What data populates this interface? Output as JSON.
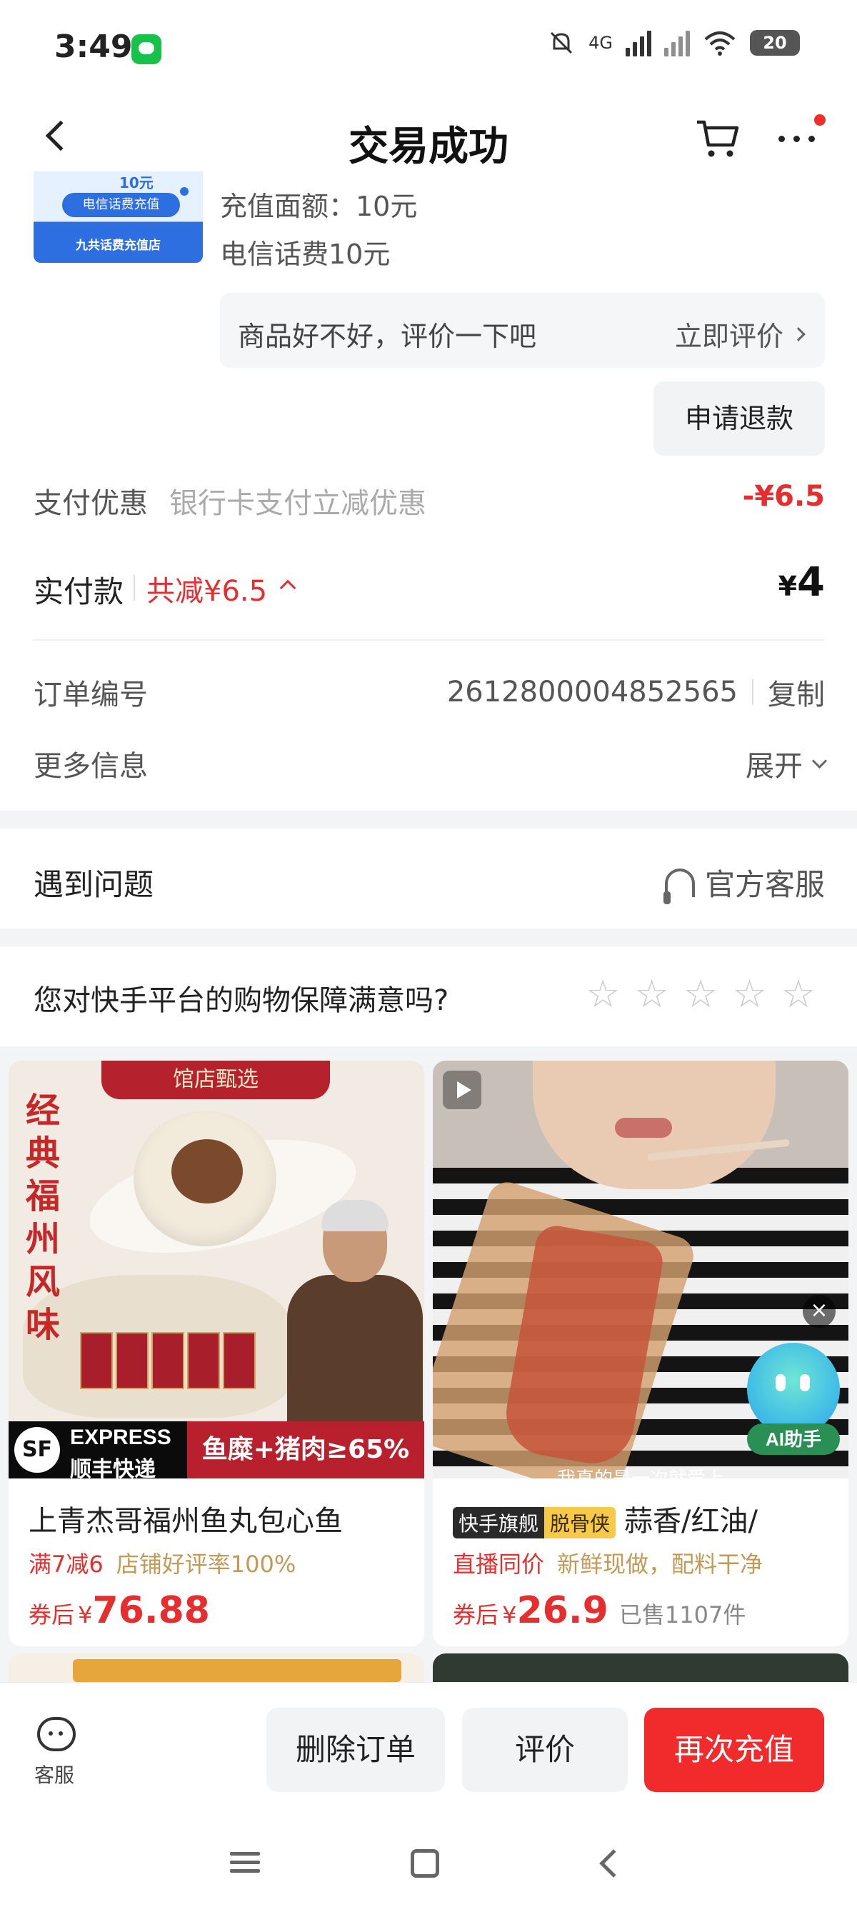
{
  "status_bar": {
    "time": "3:49",
    "network": "4G",
    "battery": "20",
    "icons": [
      "message-icon",
      "mute-icon",
      "signal-icon",
      "no-signal-icon",
      "wifi-icon",
      "battery-icon"
    ]
  },
  "header": {
    "title": "交易成功",
    "icons": [
      "back-icon",
      "cart-icon",
      "more-icon"
    ]
  },
  "product": {
    "thumb_top": "10元",
    "thumb_pill": "电信话费充值",
    "thumb_bottom": "九共话费充值店",
    "spec_amount": "充值面额：10元",
    "spec_name": "电信话费10元"
  },
  "review_prompt": {
    "text": "商品好不好，评价一下吧",
    "link": "立即评价"
  },
  "refund_button": "申请退款",
  "payment_discount": {
    "label": "支付优惠",
    "desc": "银行卡支付立减优惠",
    "value": "-¥6.5"
  },
  "paid": {
    "label": "实付款",
    "saved": "共减¥6.5",
    "currency": "¥",
    "amount": "4"
  },
  "order": {
    "label": "订单编号",
    "number": "2612800004852565",
    "copy": "复制"
  },
  "more_info": {
    "label": "更多信息",
    "expand": "展开"
  },
  "problem": {
    "label": "遇到问题",
    "service": "官方客服"
  },
  "survey": {
    "question": "您对快手平台的购物保障满意吗?",
    "stars": 5,
    "rating": 0
  },
  "recommendations": [
    {
      "banner": "馆店甄选",
      "vertical_text": "经典福州风味",
      "express_en": "EXPRESS",
      "express_cn": "顺丰快递",
      "sf": "SF",
      "ingredient": "鱼糜+猪肉≥65%",
      "title": "上青杰哥福州鱼丸包心鱼",
      "tag_red": "满7减6",
      "tag_gold": "店铺好评率100%",
      "price_prefix": "券后",
      "currency": "¥",
      "price": "76.88",
      "sold": ""
    },
    {
      "badge_brand": "快手旗舰",
      "badge_ribbon": "脱骨侠",
      "title": "蒜香/红油/",
      "tag_red": "直播同价",
      "tag_gold": "新鲜现做，配料干净",
      "price_prefix": "券后",
      "currency": "¥",
      "price": "26.9",
      "sold": "已售1107件",
      "subtitle": "我真的是一次就爱上",
      "ai_label": "AI助手"
    }
  ],
  "action_bar": {
    "service_label": "客服",
    "delete": "删除订单",
    "evaluate": "评价",
    "recharge": "再次充值"
  },
  "colors": {
    "accent_red": "#f12b2b",
    "price_red": "#e62e2e",
    "gold": "#c29a56",
    "background_gray": "#f3f4f6"
  }
}
